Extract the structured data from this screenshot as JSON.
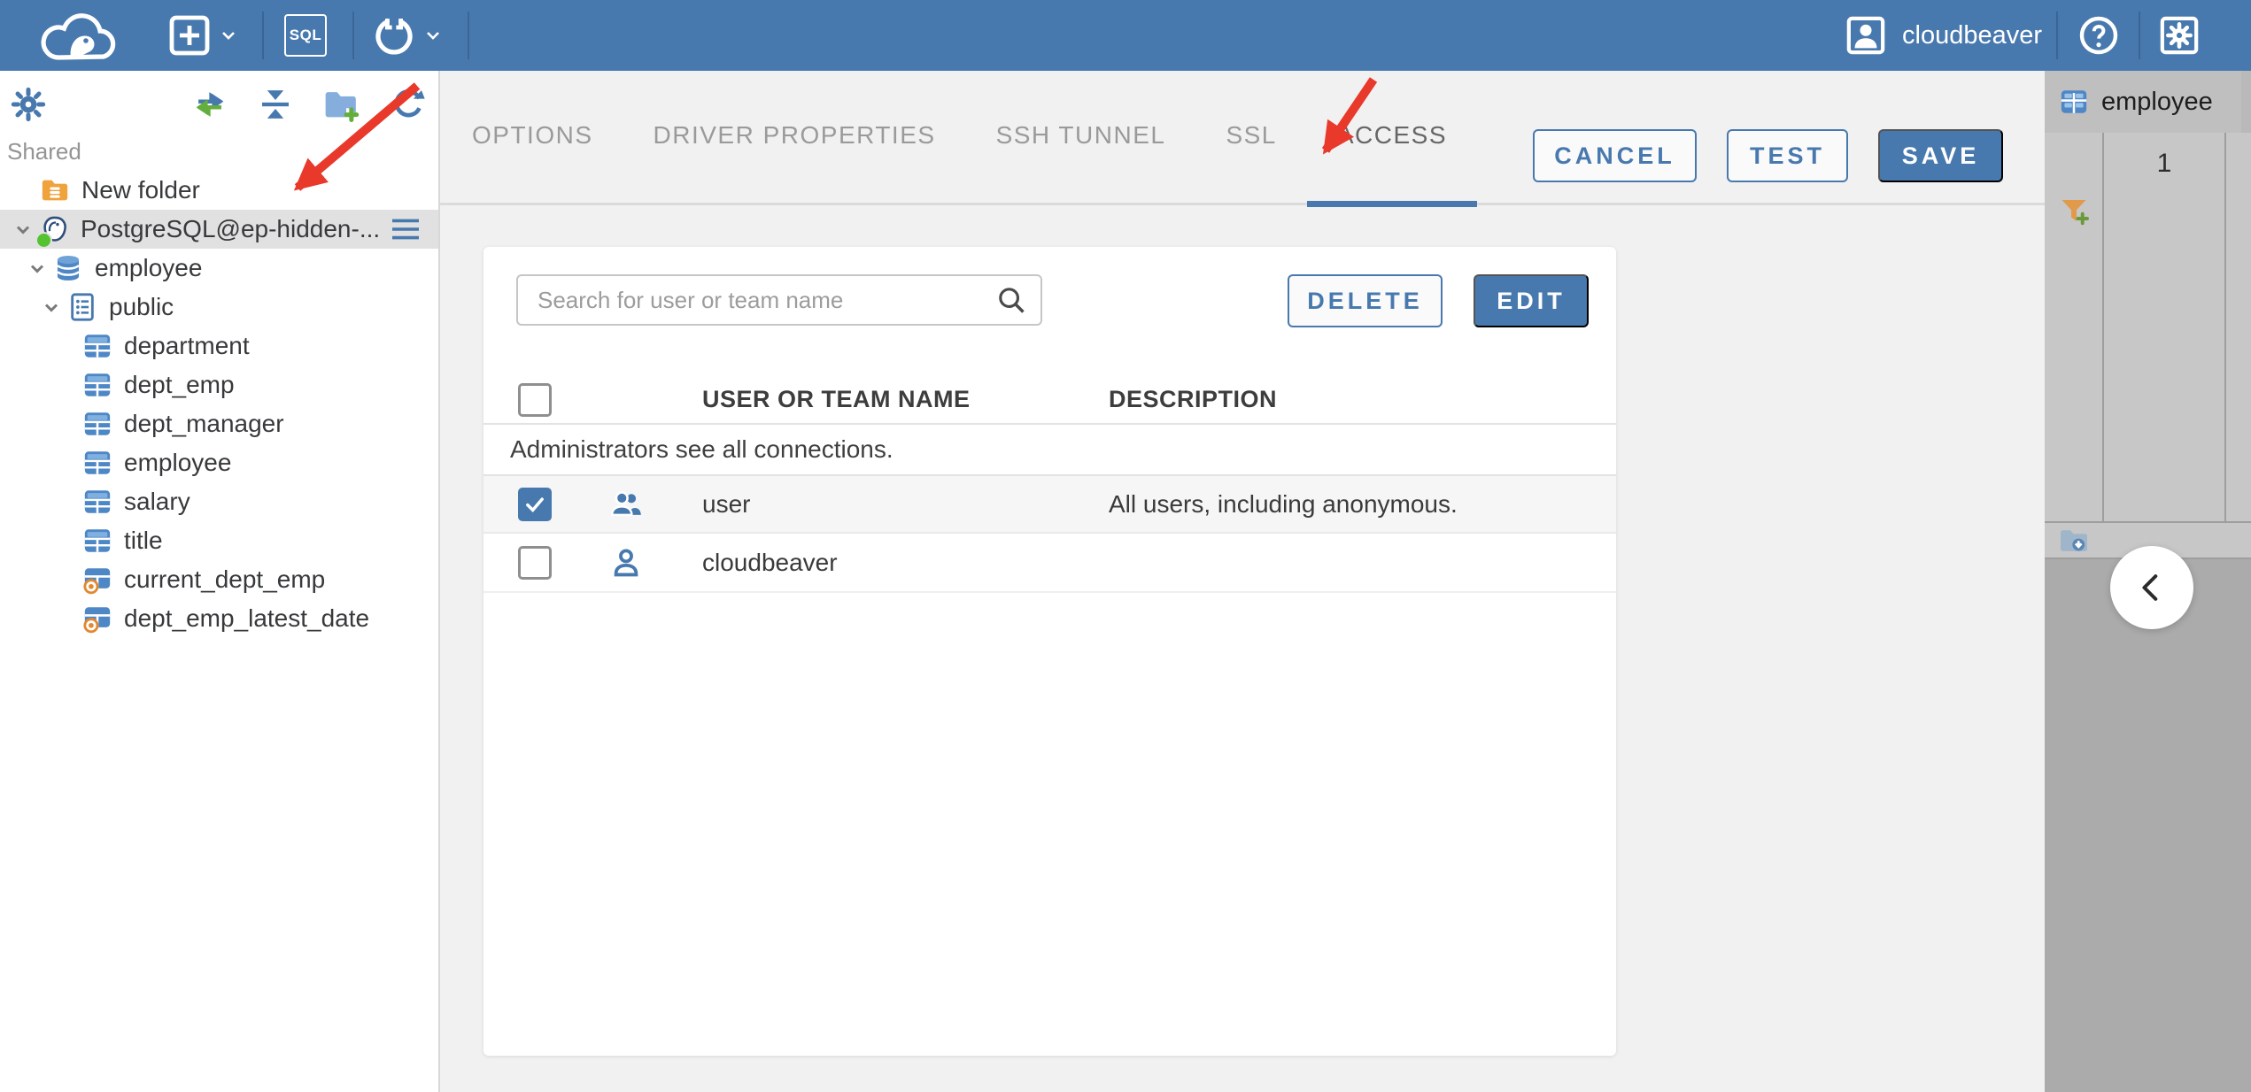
{
  "header": {
    "logo_icon": "cloudbeaver-logo",
    "new_connection_icon": "plus-square-icon",
    "sql_editor_label": "SQL",
    "driver_manager_icon": "wrench-icon",
    "user": {
      "icon": "user-avatar-icon",
      "label": "cloudbeaver"
    },
    "help_icon": "help-icon",
    "settings_icon": "settings-gear-icon"
  },
  "sidebar": {
    "section_label": "Shared",
    "toolbar_icons": [
      "gear-icon",
      "sync-arrows-icon",
      "collapse-all-icon",
      "add-folder-icon",
      "refresh-icon"
    ],
    "tree": [
      {
        "label": "New folder",
        "icon": "folder-database-icon"
      },
      {
        "label": "PostgreSQL@ep-hidden-...",
        "icon": "postgresql-icon",
        "status": "connected",
        "selected": true,
        "expanded": true
      },
      {
        "label": "employee",
        "icon": "database-icon",
        "expanded": true
      },
      {
        "label": "public",
        "icon": "schema-icon",
        "expanded": true
      },
      {
        "label": "department",
        "icon": "table-icon"
      },
      {
        "label": "dept_emp",
        "icon": "table-icon"
      },
      {
        "label": "dept_manager",
        "icon": "table-icon"
      },
      {
        "label": "employee",
        "icon": "table-icon"
      },
      {
        "label": "salary",
        "icon": "table-icon"
      },
      {
        "label": "title",
        "icon": "table-icon"
      },
      {
        "label": "current_dept_emp",
        "icon": "view-icon"
      },
      {
        "label": "dept_emp_latest_date",
        "icon": "view-icon"
      }
    ]
  },
  "main": {
    "tabs": [
      {
        "label": "OPTIONS",
        "active": false
      },
      {
        "label": "DRIVER PROPERTIES",
        "active": false
      },
      {
        "label": "SSH TUNNEL",
        "active": false
      },
      {
        "label": "SSL",
        "active": false
      },
      {
        "label": "ACCESS",
        "active": true
      }
    ],
    "actions": {
      "cancel": "CANCEL",
      "test": "TEST",
      "save": "SAVE"
    },
    "access": {
      "search_placeholder": "Search for user or team name",
      "delete_label": "DELETE",
      "edit_label": "EDIT",
      "table": {
        "columns": {
          "name": "USER OR TEAM NAME",
          "description": "DESCRIPTION"
        },
        "notice": "Administrators see all connections.",
        "rows": [
          {
            "name": "user",
            "description": "All users, including anonymous.",
            "checked": true,
            "icon": "team-icon"
          },
          {
            "name": "cloudbeaver",
            "description": "",
            "checked": false,
            "icon": "person-icon"
          }
        ]
      }
    }
  },
  "right_panel": {
    "tab": {
      "icon": "table-icon",
      "label": "employee"
    },
    "row_number": "1",
    "toolbar_icons": [
      "add-filter-icon",
      "script-run-icon",
      "grid-view-icon",
      "export-document-icon",
      "ai-assistant-icon",
      "copy-icon",
      "log-output-icon",
      "save-results-icon"
    ],
    "collapse_icon": "chevron-left-icon"
  },
  "annotations": {
    "arrow_color": "#E8392B",
    "arrows": [
      {
        "target": "PostgreSQL connection tree item"
      },
      {
        "target": "ACCESS tab"
      }
    ]
  },
  "colors": {
    "accent_blue": "#4879AE",
    "header_blue": "#4879AE",
    "status_green": "#55C232",
    "folder_orange": "#F0A23C",
    "arrow_red": "#E8392B"
  }
}
